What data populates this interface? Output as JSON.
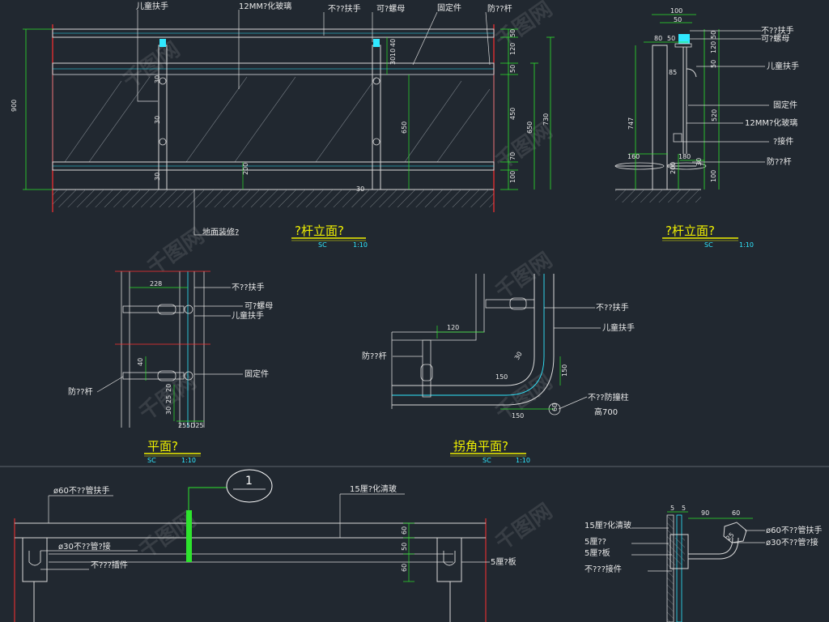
{
  "colors": {
    "background": "#212830",
    "white_line": "#d9d9d9",
    "cyan_line": "#30e8ff",
    "green_line": "#2de32d",
    "red_line": "#ff3030",
    "yellow_text": "#f0f000",
    "grey_line": "#9aa0a8"
  },
  "watermark": "千图网",
  "elevation": {
    "labels": {
      "child_handrail": "儿童扶手",
      "glass": "12MM?化玻璃",
      "ss_handrail": "不??扶手",
      "nut": "可?螺母",
      "fixing": "固定件",
      "crash_bar": "防??杆"
    },
    "floor_note": "地面装修?",
    "dims": {
      "overall_height": "900",
      "d1": "50",
      "d2": "120",
      "d3": "50",
      "d4": "450",
      "d5": "70",
      "d6": "100",
      "h1": "650",
      "h2": "730",
      "post_inner": "650",
      "post_h1": "40",
      "post_h2": "10",
      "post_h3": "30",
      "post_h4": "200",
      "post_h5": "30"
    },
    "title": "?杆立面?",
    "scale_left": "SC",
    "scale_right": "1:10"
  },
  "section": {
    "labels": {
      "ss_handrail": "不??扶手",
      "nut": "可?螺母",
      "child_handrail": "儿童扶手",
      "fixing": "固定件",
      "glass": "12MM?化玻璃",
      "connector": "?接件",
      "crash_bar": "防??杆"
    },
    "dims": {
      "w100": "100",
      "w50": "50",
      "w80": "80",
      "w50b": "50",
      "left_h": "747",
      "right_h": "520",
      "d_a": "50",
      "d_b": "120",
      "d_c": "50",
      "d_d": "100",
      "h_85": "85",
      "w160": "160",
      "w180": "180",
      "h200": "200",
      "h100": "100",
      "h30": "30"
    },
    "title": "?杆立面?",
    "scale_left": "SC",
    "scale_right": "1:10"
  },
  "plan": {
    "labels": {
      "ss_handrail": "不??扶手",
      "nut": "可?螺母",
      "child_handrail": "儿童扶手",
      "fixing": "固定件",
      "crash_bar": "防??杆"
    },
    "dims": {
      "w228": "228",
      "d40": "40",
      "d20": "20",
      "d25": "25",
      "b255": "255D25",
      "d30": "30"
    },
    "title": "平面?",
    "scale_left": "SC",
    "scale_right": "1:10"
  },
  "corner": {
    "labels": {
      "ss_handrail": "不??扶手",
      "child_handrail": "儿童扶手",
      "crash_bar": "防??杆",
      "bollard": "不??防撞柱",
      "bollard_height": "高700"
    },
    "dims": {
      "w120": "120",
      "r30": "30",
      "r150": "150",
      "w150": "150",
      "h150": "150",
      "d60": "60"
    },
    "title": "拐角平面?",
    "scale_left": "SC",
    "scale_right": "1:10"
  },
  "bottom_left": {
    "labels": {
      "pipe60": "ø60不??管扶手",
      "pipe30": "ø30不??管?接",
      "fitting": "不???插件",
      "glass15": "15厘?化清玻",
      "plate5": "5厘?板"
    },
    "dims": {
      "d60": "60",
      "d50": "50",
      "d60b": "60"
    },
    "callout_number": "1"
  },
  "bottom_right": {
    "labels": {
      "glass15": "15厘?化清玻",
      "thick5a": "5厘??",
      "plate5": "5厘?板",
      "connector": "不???接件",
      "pipe60": "ø60不??管扶手",
      "pipe30": "ø30不??管?接"
    },
    "dims": {
      "d5": "5",
      "d5b": "5",
      "d90": "90",
      "d60": "60",
      "d25": "25"
    }
  }
}
